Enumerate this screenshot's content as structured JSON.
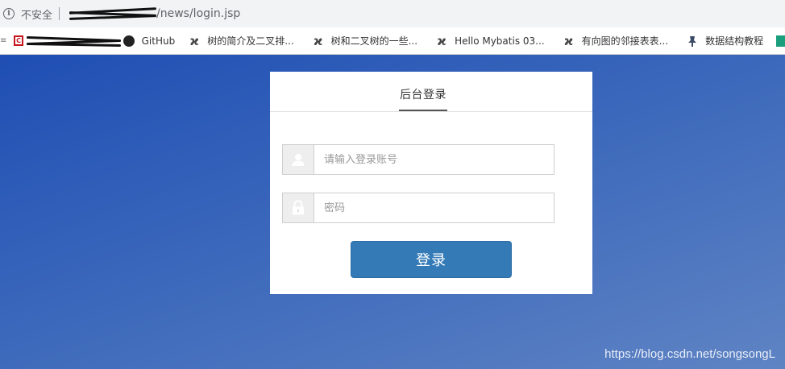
{
  "addressbar": {
    "security_label": "不安全",
    "url_path": "/news/login.jsp"
  },
  "bookmarks": [
    {
      "label": "GitHub",
      "icon": "github-icon"
    },
    {
      "label": "树的简介及二叉排...",
      "icon": "feather-icon"
    },
    {
      "label": "树和二叉树的一些...",
      "icon": "feather-icon"
    },
    {
      "label": "Hello Mybatis 03...",
      "icon": "feather-icon"
    },
    {
      "label": "有向图的邻接表表...",
      "icon": "feather-icon"
    },
    {
      "label": "数据结构教程",
      "icon": "pin-icon"
    }
  ],
  "login": {
    "tab_title": "后台登录",
    "username_placeholder": "请输入登录账号",
    "password_placeholder": "密码",
    "submit_label": "登录"
  },
  "watermark": "https://blog.csdn.net/songsongL",
  "colors": {
    "button": "#337ab7",
    "background": "#2a56b5"
  }
}
